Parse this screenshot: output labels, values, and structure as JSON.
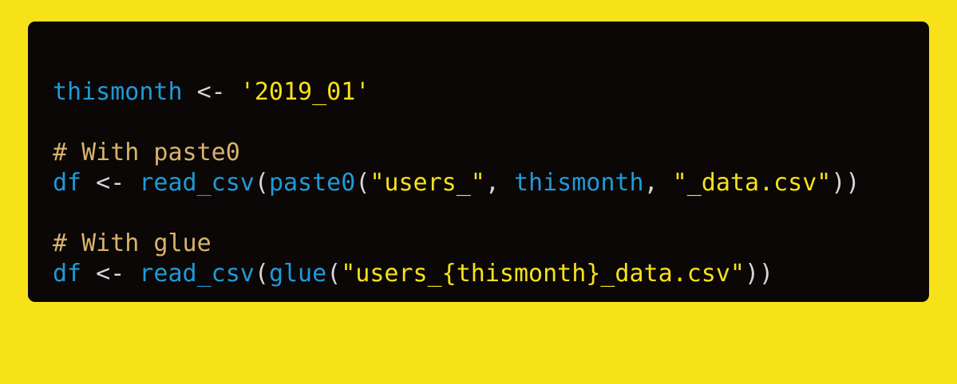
{
  "colors": {
    "background": "#f7e119",
    "panel": "#0a0706",
    "identifier": "#1f9ad8",
    "operator": "#d7d7d7",
    "string": "#f7e119",
    "comment": "#d9b26b"
  },
  "code": {
    "line1": {
      "var": "thismonth",
      "op": " <- ",
      "str": "'2019_01'"
    },
    "line2": {
      "comment": "# With paste0"
    },
    "line3": {
      "var": "df",
      "op": " <- ",
      "fn1": "read_csv",
      "p1": "(",
      "fn2": "paste0",
      "p2": "(",
      "str1": "\"users_\"",
      "sep1": ", ",
      "arg": "thismonth",
      "sep2": ", ",
      "str2": "\"_data.csv\"",
      "close": "))"
    },
    "line4": {
      "comment": "# With glue"
    },
    "line5": {
      "var": "df",
      "op": " <- ",
      "fn1": "read_csv",
      "p1": "(",
      "fn2": "glue",
      "p2": "(",
      "str": "\"users_{thismonth}_data.csv\"",
      "close": "))"
    }
  }
}
